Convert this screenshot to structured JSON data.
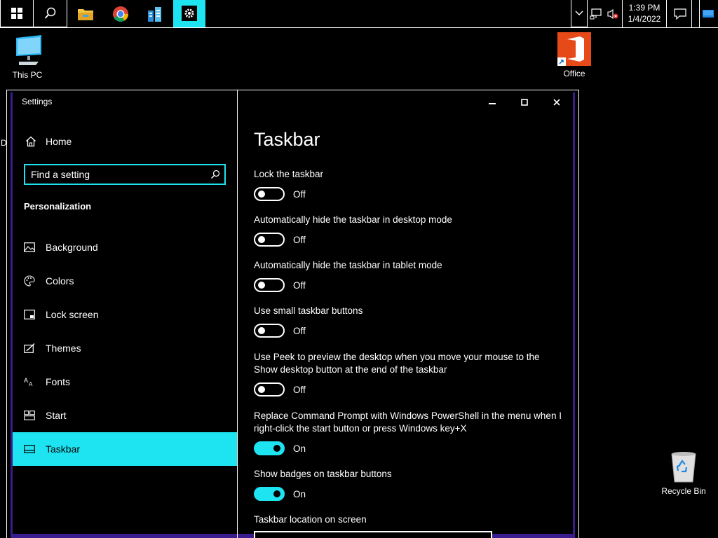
{
  "taskbar": {
    "apps": [
      {
        "name": "file-explorer"
      },
      {
        "name": "chrome"
      },
      {
        "name": "server-manager"
      },
      {
        "name": "settings"
      }
    ],
    "clock": {
      "time": "1:39 PM",
      "date": "1/4/2022"
    }
  },
  "desktop": {
    "icons": [
      {
        "label": "This PC"
      },
      {
        "label": "Office"
      },
      {
        "label": "Recycle Bin"
      }
    ],
    "edge_glyph": "D"
  },
  "window": {
    "title": "Settings",
    "controls": {
      "minimize": "—",
      "maximize": "□",
      "close": "✕"
    }
  },
  "sidebar": {
    "home_label": "Home",
    "search_placeholder": "Find a setting",
    "section_title": "Personalization",
    "items": [
      {
        "label": "Background",
        "icon": "picture-icon"
      },
      {
        "label": "Colors",
        "icon": "palette-icon"
      },
      {
        "label": "Lock screen",
        "icon": "lock-screen-icon"
      },
      {
        "label": "Themes",
        "icon": "themes-icon"
      },
      {
        "label": "Fonts",
        "icon": "fonts-icon"
      },
      {
        "label": "Start",
        "icon": "start-icon"
      },
      {
        "label": "Taskbar",
        "icon": "taskbar-icon",
        "selected": true
      }
    ]
  },
  "content": {
    "title": "Taskbar",
    "settings": [
      {
        "label": "Lock the taskbar",
        "state": "Off"
      },
      {
        "label": "Automatically hide the taskbar in desktop mode",
        "state": "Off"
      },
      {
        "label": "Automatically hide the taskbar in tablet mode",
        "state": "Off"
      },
      {
        "label": "Use small taskbar buttons",
        "state": "Off"
      },
      {
        "label": "Use Peek to preview the desktop when you move your mouse to the Show desktop button at the end of the taskbar",
        "state": "Off"
      },
      {
        "label": "Replace Command Prompt with Windows PowerShell in the menu when I right-click the start button or press Windows key+X",
        "state": "On"
      },
      {
        "label": "Show badges on taskbar buttons",
        "state": "On"
      }
    ],
    "location_label": "Taskbar location on screen"
  },
  "colors": {
    "accent": "#1ee4f2",
    "frame": "#3a1c8f"
  }
}
